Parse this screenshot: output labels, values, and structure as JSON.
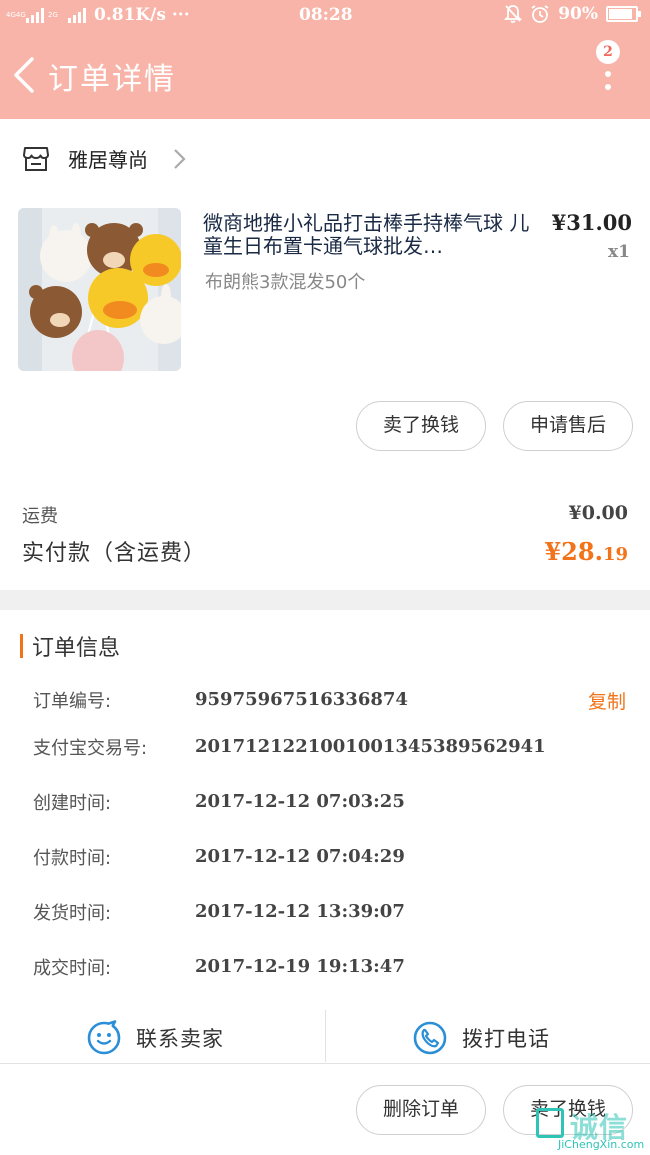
{
  "status_bar": {
    "network_type_1": "4G4G",
    "network_type_2": "2G",
    "speed": "0.81K/s ···",
    "time": "08:28",
    "battery_percent": "90%",
    "battery_level": 0.9
  },
  "header": {
    "title": "订单详情",
    "badge_count": "2"
  },
  "shop": {
    "name": "雅居尊尚"
  },
  "product": {
    "title": "微商地推小礼品打击棒手持棒气球 儿童生日布置卡通气球批发…",
    "price": "¥31.00",
    "quantity": "x1",
    "spec": "布朗熊3款混发50个",
    "buttons": {
      "sell_for_cash": "卖了换钱",
      "apply_after_sale": "申请售后"
    }
  },
  "fees": {
    "shipping_label": "运费",
    "shipping_value": "¥0.00",
    "paid_label": "实付款（含运费）",
    "paid_value_main": "¥28.",
    "paid_value_cents": "19"
  },
  "order_info": {
    "section_title": "订单信息",
    "copy_label": "复制",
    "rows": [
      {
        "label": "订单编号:",
        "value": "95975967516336874"
      },
      {
        "label": "支付宝交易号:",
        "value": "2017121221001001345389562941"
      },
      {
        "label": "创建时间:",
        "value": "2017-12-12 07:03:25"
      },
      {
        "label": "付款时间:",
        "value": "2017-12-12 07:04:29"
      },
      {
        "label": "发货时间:",
        "value": "2017-12-12 13:39:07"
      },
      {
        "label": "成交时间:",
        "value": "2017-12-19 19:13:47"
      }
    ]
  },
  "contact": {
    "contact_seller": "联系卖家",
    "call_phone": "拨打电话"
  },
  "bottom_actions": {
    "delete_order": "删除订单",
    "sell_for_cash": "卖了换钱"
  },
  "watermark": {
    "brand": "诚信",
    "url": "JiChengXin.com"
  },
  "colors": {
    "header_pink": "#f8b4a8",
    "accent_orange": "#f2731a",
    "icon_blue": "#2b8fd8"
  }
}
